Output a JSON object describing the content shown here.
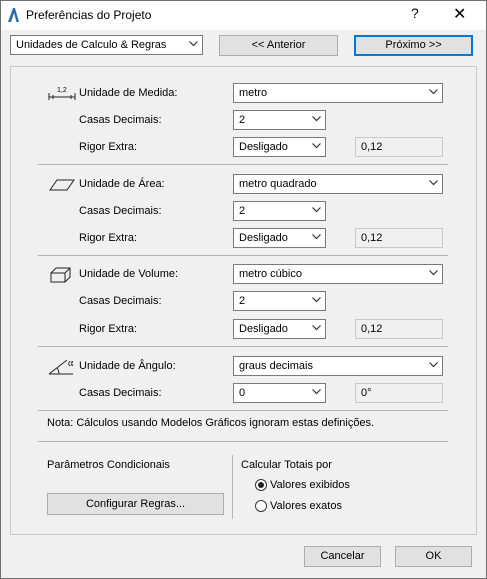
{
  "window": {
    "title": "Preferências do Projeto",
    "help_glyph": "?",
    "close_glyph": "✕"
  },
  "nav": {
    "section_value": "Unidades de Calculo & Regras",
    "prev_label": "<< Anterior",
    "next_label": "Próximo >>"
  },
  "length": {
    "label": "Unidade de Medida:",
    "unit_value": "metro",
    "decimals_label": "Casas Decimais:",
    "decimals_value": "2",
    "rigor_label": "Rigor Extra:",
    "rigor_value": "Desligado",
    "sample": "0,12"
  },
  "area": {
    "label": "Unidade de Área:",
    "unit_value": "metro quadrado",
    "decimals_label": "Casas Decimais:",
    "decimals_value": "2",
    "rigor_label": "Rigor Extra:",
    "rigor_value": "Desligado",
    "sample": "0,12"
  },
  "volume": {
    "label": "Unidade de Volume:",
    "unit_value": "metro cúbico",
    "decimals_label": "Casas Decimais:",
    "decimals_value": "2",
    "rigor_label": "Rigor Extra:",
    "rigor_value": "Desligado",
    "sample": "0,12"
  },
  "angle": {
    "label": "Unidade de Ângulo:",
    "unit_value": "graus decimais",
    "decimals_label": "Casas Decimais:",
    "decimals_value": "0",
    "sample": "0°"
  },
  "icons": {
    "length_icon_text": "1,2",
    "angle_icon_text": "α"
  },
  "note": "Nota: Cálculos usando Modelos Gráficos ignoram estas definições.",
  "conditional": {
    "title": "Parâmetros Condicionais",
    "configure_label": "Configurar Regras..."
  },
  "totals": {
    "title": "Calcular Totais por",
    "option_shown": "Valores exibidos",
    "option_exact": "Valores exatos",
    "selected": "Valores exibidos"
  },
  "footer": {
    "cancel_label": "Cancelar",
    "ok_label": "OK"
  }
}
